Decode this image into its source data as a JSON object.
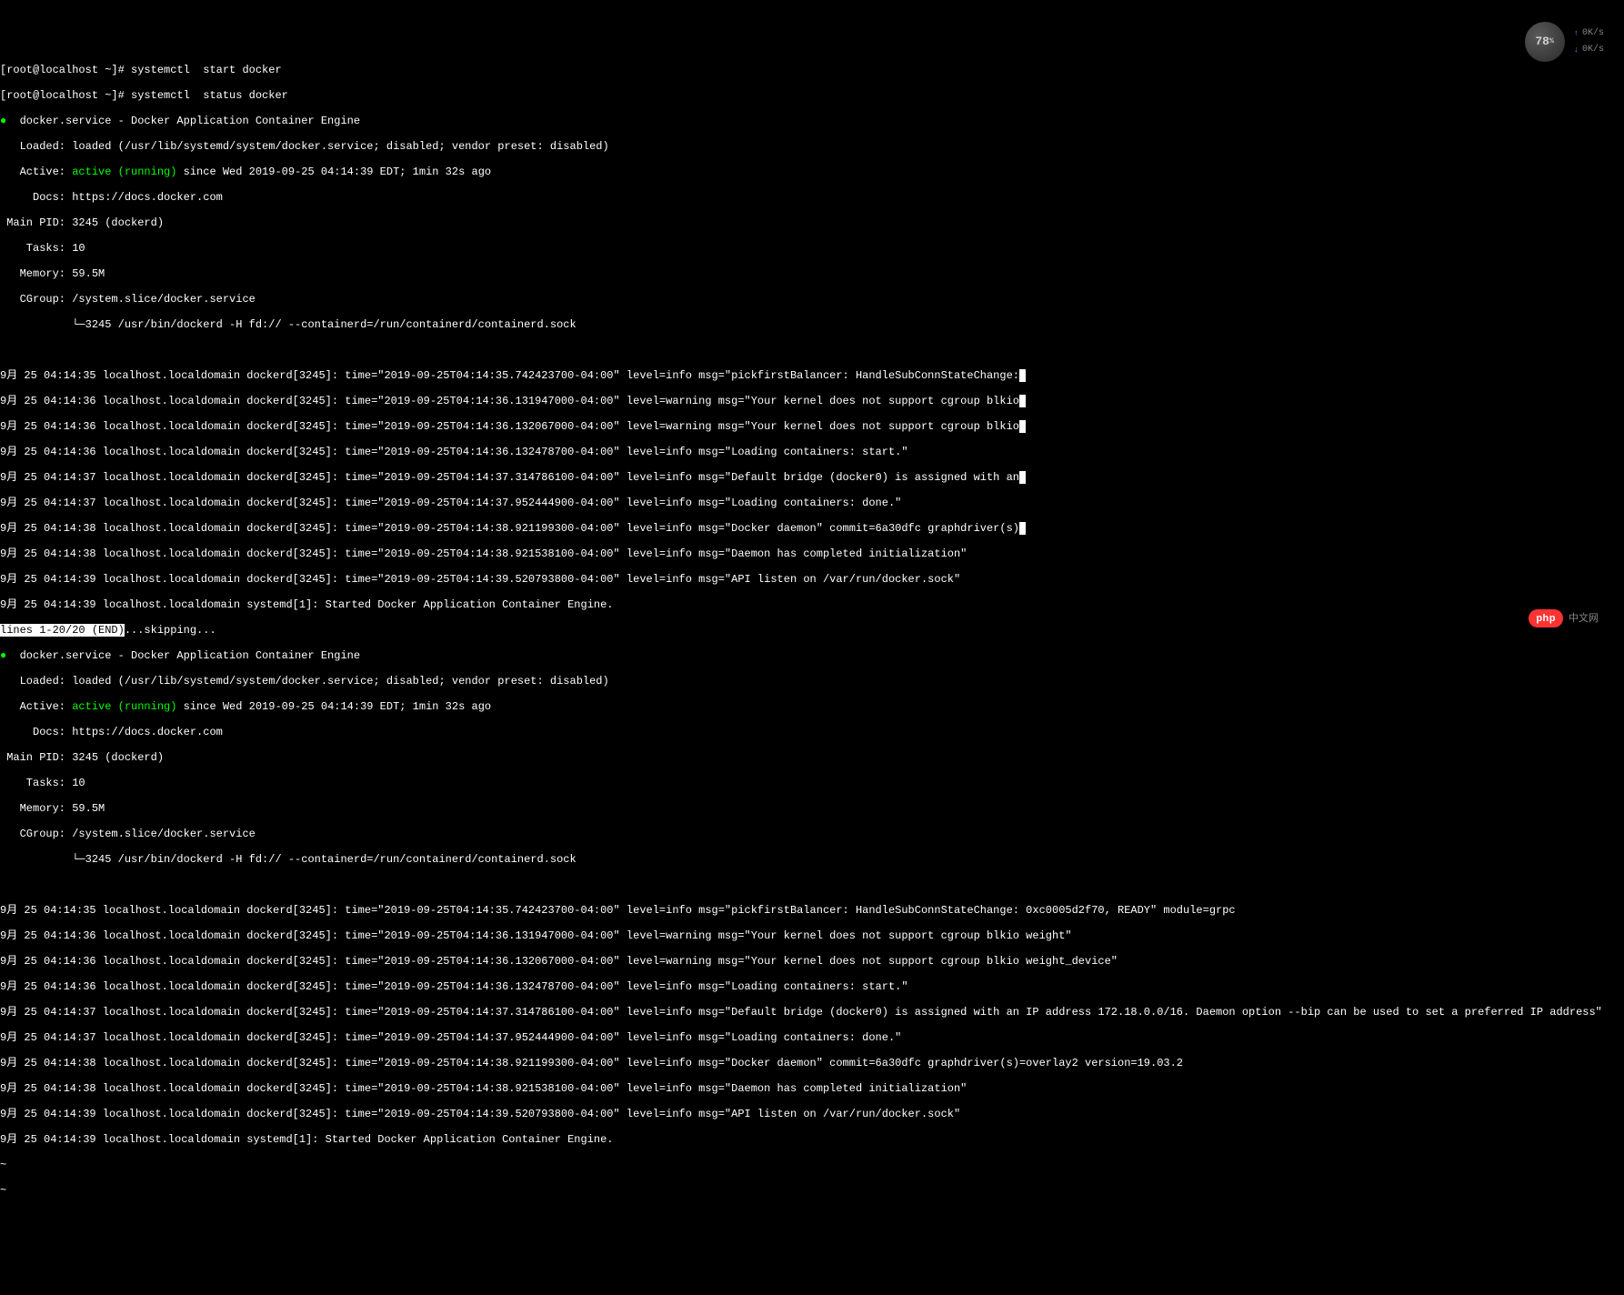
{
  "prompts": {
    "line1_prefix": "[root@localhost ~]# ",
    "line1_cmd": "systemctl  start docker",
    "line2_prefix": "[root@localhost ~]# ",
    "line2_cmd": "systemctl  status docker"
  },
  "status1": {
    "bullet": "●",
    "title": "  docker.service - Docker Application Container Engine",
    "loaded": "   Loaded: loaded (/usr/lib/systemd/system/docker.service; disabled; vendor preset: disabled)",
    "active_label": "   Active: ",
    "active_value": "active (running)",
    "active_since": " since Wed 2019-09-25 04:14:39 EDT; 1min 32s ago",
    "docs": "     Docs: https://docs.docker.com",
    "mainpid": " Main PID: 3245 (dockerd)",
    "tasks": "    Tasks: 10",
    "memory": "   Memory: 59.5M",
    "cgroup": "   CGroup: /system.slice/docker.service",
    "cgroup_child": "           └─3245 /usr/bin/dockerd -H fd:// --containerd=/run/containerd/containerd.sock"
  },
  "logs1": {
    "l1": "9月 25 04:14:35 localhost.localdomain dockerd[3245]: time=\"2019-09-25T04:14:35.742423700-04:00\" level=info msg=\"pickfirstBalancer: HandleSubConnStateChange:",
    "l2": "9月 25 04:14:36 localhost.localdomain dockerd[3245]: time=\"2019-09-25T04:14:36.131947000-04:00\" level=warning msg=\"Your kernel does not support cgroup blkio",
    "l3": "9月 25 04:14:36 localhost.localdomain dockerd[3245]: time=\"2019-09-25T04:14:36.132067000-04:00\" level=warning msg=\"Your kernel does not support cgroup blkio",
    "l4": "9月 25 04:14:36 localhost.localdomain dockerd[3245]: time=\"2019-09-25T04:14:36.132478700-04:00\" level=info msg=\"Loading containers: start.\"",
    "l5": "9月 25 04:14:37 localhost.localdomain dockerd[3245]: time=\"2019-09-25T04:14:37.314786100-04:00\" level=info msg=\"Default bridge (docker0) is assigned with an",
    "l6": "9月 25 04:14:37 localhost.localdomain dockerd[3245]: time=\"2019-09-25T04:14:37.952444900-04:00\" level=info msg=\"Loading containers: done.\"",
    "l7": "9月 25 04:14:38 localhost.localdomain dockerd[3245]: time=\"2019-09-25T04:14:38.921199300-04:00\" level=info msg=\"Docker daemon\" commit=6a30dfc graphdriver(s)",
    "l8": "9月 25 04:14:38 localhost.localdomain dockerd[3245]: time=\"2019-09-25T04:14:38.921538100-04:00\" level=info msg=\"Daemon has completed initialization\"",
    "l9": "9月 25 04:14:39 localhost.localdomain dockerd[3245]: time=\"2019-09-25T04:14:39.520793800-04:00\" level=info msg=\"API listen on /var/run/docker.sock\"",
    "l10": "9月 25 04:14:39 localhost.localdomain systemd[1]: Started Docker Application Container Engine."
  },
  "pager": {
    "status": "lines 1-20/20 (END)",
    "skipping": "...skipping..."
  },
  "status2": {
    "bullet": "●",
    "title": "  docker.service - Docker Application Container Engine",
    "loaded": "   Loaded: loaded (/usr/lib/systemd/system/docker.service; disabled; vendor preset: disabled)",
    "active_label": "   Active: ",
    "active_value": "active (running)",
    "active_since": " since Wed 2019-09-25 04:14:39 EDT; 1min 32s ago",
    "docs": "     Docs: https://docs.docker.com",
    "mainpid": " Main PID: 3245 (dockerd)",
    "tasks": "    Tasks: 10",
    "memory": "   Memory: 59.5M",
    "cgroup": "   CGroup: /system.slice/docker.service",
    "cgroup_child": "           └─3245 /usr/bin/dockerd -H fd:// --containerd=/run/containerd/containerd.sock"
  },
  "logs2": {
    "l1": "9月 25 04:14:35 localhost.localdomain dockerd[3245]: time=\"2019-09-25T04:14:35.742423700-04:00\" level=info msg=\"pickfirstBalancer: HandleSubConnStateChange: 0xc0005d2f70, READY\" module=grpc",
    "l2": "9月 25 04:14:36 localhost.localdomain dockerd[3245]: time=\"2019-09-25T04:14:36.131947000-04:00\" level=warning msg=\"Your kernel does not support cgroup blkio weight\"",
    "l3": "9月 25 04:14:36 localhost.localdomain dockerd[3245]: time=\"2019-09-25T04:14:36.132067000-04:00\" level=warning msg=\"Your kernel does not support cgroup blkio weight_device\"",
    "l4": "9月 25 04:14:36 localhost.localdomain dockerd[3245]: time=\"2019-09-25T04:14:36.132478700-04:00\" level=info msg=\"Loading containers: start.\"",
    "l5": "9月 25 04:14:37 localhost.localdomain dockerd[3245]: time=\"2019-09-25T04:14:37.314786100-04:00\" level=info msg=\"Default bridge (docker0) is assigned with an IP address 172.18.0.0/16. Daemon option --bip can be used to set a preferred IP address\"",
    "l6": "9月 25 04:14:37 localhost.localdomain dockerd[3245]: time=\"2019-09-25T04:14:37.952444900-04:00\" level=info msg=\"Loading containers: done.\"",
    "l7": "9月 25 04:14:38 localhost.localdomain dockerd[3245]: time=\"2019-09-25T04:14:38.921199300-04:00\" level=info msg=\"Docker daemon\" commit=6a30dfc graphdriver(s)=overlay2 version=19.03.2",
    "l8": "9月 25 04:14:38 localhost.localdomain dockerd[3245]: time=\"2019-09-25T04:14:38.921538100-04:00\" level=info msg=\"Daemon has completed initialization\"",
    "l9": "9月 25 04:14:39 localhost.localdomain dockerd[3245]: time=\"2019-09-25T04:14:39.520793800-04:00\" level=info msg=\"API listen on /var/run/docker.sock\"",
    "l10": "9月 25 04:14:39 localhost.localdomain systemd[1]: Started Docker Application Container Engine."
  },
  "tilde": {
    "t1": "~",
    "t2": "~"
  },
  "widget": {
    "percent": "78",
    "pct_sign": "%",
    "up": "0K/s",
    "down": "0K/s"
  },
  "watermark": {
    "badge": "php",
    "text": "中文网"
  }
}
